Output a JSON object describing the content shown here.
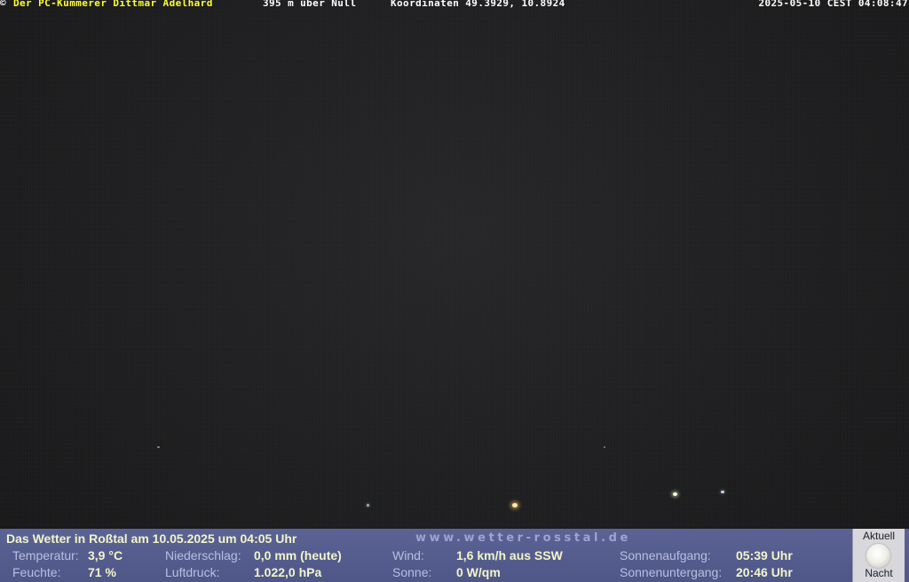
{
  "top_bar": {
    "copyright_symbol": "©",
    "owner": "Der PC-Kümmerer Dittmar Adelhard",
    "altitude": "395 m über Null",
    "coordinates": "Koordinaten 49.3929, 10.8924",
    "datetime": "2025-05-10 CEST 04:08:47"
  },
  "weather": {
    "title": "Das Wetter in Roßtal am 10.05.2025 um 04:05 Uhr",
    "url": "www.wetter-rosstal.de",
    "temperature_label": "Temperatur:",
    "temperature_value": "3,9 °C",
    "humidity_label": "Feuchte:",
    "humidity_value": "71 %",
    "precipitation_label": "Niederschlag:",
    "precipitation_value": "0,0 mm (heute)",
    "pressure_label": "Luftdruck:",
    "pressure_value": "1.022,0 hPa",
    "wind_label": "Wind:",
    "wind_value": "1,6 km/h aus SSW",
    "sun_label": "Sonne:",
    "sun_value": "0 W/qm",
    "sunrise_label": "Sonnenaufgang:",
    "sunrise_value": "05:39 Uhr",
    "sunset_label": "Sonnenuntergang:",
    "sunset_value": "20:46 Uhr"
  },
  "moon": {
    "label_top": "Aktuell",
    "label_bottom": "Nacht",
    "icon": "full-moon-icon"
  },
  "colors": {
    "panel_background": "#5b6394",
    "owner_text": "#ffff33",
    "value_text": "#f3f5c8"
  }
}
